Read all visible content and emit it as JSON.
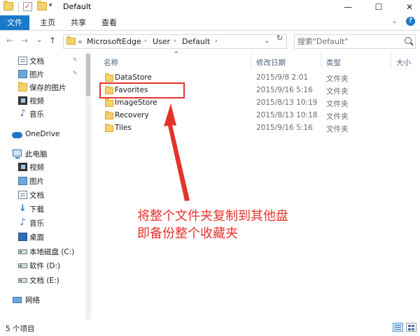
{
  "window": {
    "title": "Default",
    "minimize": "—",
    "maximize": "☐",
    "close": "✕"
  },
  "quick_access_toolbar": {
    "dropdown": "▾"
  },
  "ribbon": {
    "tabs": [
      "文件",
      "主页",
      "共享",
      "查看"
    ],
    "expand": "⌄",
    "help": "?"
  },
  "nav": {
    "back": "←",
    "forward": "→",
    "recent": "⌄",
    "up": "↑"
  },
  "address": {
    "overflow": "«",
    "crumbs": [
      "MicrosoftEdge",
      "User",
      "Default"
    ],
    "separator": "›",
    "dropdown": "⌄",
    "refresh": "↻"
  },
  "search": {
    "placeholder": "搜索\"Default\""
  },
  "sidebar": {
    "quick_access": [
      {
        "label": "文档",
        "icon": "document-icon",
        "pinned": true
      },
      {
        "label": "图片",
        "icon": "picture-icon",
        "pinned": true
      },
      {
        "label": "保存的图片",
        "icon": "folder-icon",
        "pinned": false
      },
      {
        "label": "视频",
        "icon": "video-icon",
        "pinned": false
      },
      {
        "label": "音乐",
        "icon": "music-icon",
        "pinned": false
      }
    ],
    "pin_glyph": "✎",
    "onedrive": {
      "label": "OneDrive",
      "icon": "onedrive-icon"
    },
    "this_pc": {
      "label": "此电脑",
      "icon": "computer-icon"
    },
    "pc_items": [
      {
        "label": "视频",
        "icon": "video-icon"
      },
      {
        "label": "图片",
        "icon": "picture-icon"
      },
      {
        "label": "文档",
        "icon": "document-icon"
      },
      {
        "label": "下载",
        "icon": "download-icon"
      },
      {
        "label": "音乐",
        "icon": "music-icon"
      },
      {
        "label": "桌面",
        "icon": "desktop-icon"
      },
      {
        "label": "本地磁盘 (C:)",
        "icon": "drive-icon"
      },
      {
        "label": "软件 (D:)",
        "icon": "drive-icon"
      },
      {
        "label": "文档 (E:)",
        "icon": "drive-icon"
      }
    ],
    "network": {
      "label": "网络",
      "icon": "network-icon"
    }
  },
  "filelist": {
    "columns": [
      "名称",
      "修改日期",
      "类型",
      "大小"
    ],
    "sort_indicator": "^",
    "rows": [
      {
        "name": "DataStore",
        "date": "2015/9/8 2:01",
        "type": "文件夹"
      },
      {
        "name": "Favorites",
        "date": "2015/9/16 5:16",
        "type": "文件夹"
      },
      {
        "name": "ImageStore",
        "date": "2015/8/13 10:19",
        "type": "文件夹"
      },
      {
        "name": "Recovery",
        "date": "2015/8/13 10:18",
        "type": "文件夹"
      },
      {
        "name": "Tiles",
        "date": "2015/9/16 5:16",
        "type": "文件夹"
      }
    ]
  },
  "annotation": {
    "color": "#e4332c",
    "line1": "将整个文件夹复制到其他盘",
    "line2": "即备份整个收藏夹"
  },
  "status": {
    "item_count": "5 个项目"
  },
  "colors": {
    "accent": "#1979ca",
    "folder": "#f3d26b"
  }
}
